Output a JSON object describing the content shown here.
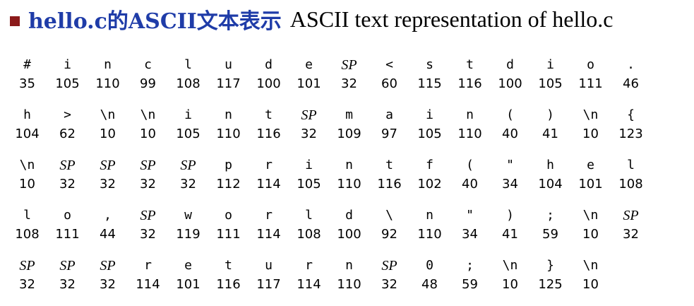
{
  "title": {
    "cn": "hello.c的ASCII文本表示",
    "en": "ASCII text representation of hello.c"
  },
  "colors": {
    "bullet": "#8b1a1a",
    "title_cn": "#1f3ca8"
  },
  "rows": [
    [
      {
        "ch": "#",
        "code": "35"
      },
      {
        "ch": "i",
        "code": "105"
      },
      {
        "ch": "n",
        "code": "110"
      },
      {
        "ch": "c",
        "code": "99"
      },
      {
        "ch": "l",
        "code": "108"
      },
      {
        "ch": "u",
        "code": "117"
      },
      {
        "ch": "d",
        "code": "100"
      },
      {
        "ch": "e",
        "code": "101"
      },
      {
        "ch": "SP",
        "code": "32"
      },
      {
        "ch": "<",
        "code": "60"
      },
      {
        "ch": "s",
        "code": "115"
      },
      {
        "ch": "t",
        "code": "116"
      },
      {
        "ch": "d",
        "code": "100"
      },
      {
        "ch": "i",
        "code": "105"
      },
      {
        "ch": "o",
        "code": "111"
      },
      {
        "ch": ".",
        "code": "46"
      }
    ],
    [
      {
        "ch": "h",
        "code": "104"
      },
      {
        "ch": ">",
        "code": "62"
      },
      {
        "ch": "\\n",
        "code": "10"
      },
      {
        "ch": "\\n",
        "code": "10"
      },
      {
        "ch": "i",
        "code": "105"
      },
      {
        "ch": "n",
        "code": "110"
      },
      {
        "ch": "t",
        "code": "116"
      },
      {
        "ch": "SP",
        "code": "32"
      },
      {
        "ch": "m",
        "code": "109"
      },
      {
        "ch": "a",
        "code": "97"
      },
      {
        "ch": "i",
        "code": "105"
      },
      {
        "ch": "n",
        "code": "110"
      },
      {
        "ch": "(",
        "code": "40"
      },
      {
        "ch": ")",
        "code": "41"
      },
      {
        "ch": "\\n",
        "code": "10"
      },
      {
        "ch": "{",
        "code": "123"
      }
    ],
    [
      {
        "ch": "\\n",
        "code": "10"
      },
      {
        "ch": "SP",
        "code": "32"
      },
      {
        "ch": "SP",
        "code": "32"
      },
      {
        "ch": "SP",
        "code": "32"
      },
      {
        "ch": "SP",
        "code": "32"
      },
      {
        "ch": "p",
        "code": "112"
      },
      {
        "ch": "r",
        "code": "114"
      },
      {
        "ch": "i",
        "code": "105"
      },
      {
        "ch": "n",
        "code": "110"
      },
      {
        "ch": "t",
        "code": "116"
      },
      {
        "ch": "f",
        "code": "102"
      },
      {
        "ch": "(",
        "code": "40"
      },
      {
        "ch": "\"",
        "code": "34"
      },
      {
        "ch": "h",
        "code": "104"
      },
      {
        "ch": "e",
        "code": "101"
      },
      {
        "ch": "l",
        "code": "108"
      }
    ],
    [
      {
        "ch": "l",
        "code": "108"
      },
      {
        "ch": "o",
        "code": "111"
      },
      {
        "ch": ",",
        "code": "44"
      },
      {
        "ch": "SP",
        "code": "32"
      },
      {
        "ch": "w",
        "code": "119"
      },
      {
        "ch": "o",
        "code": "111"
      },
      {
        "ch": "r",
        "code": "114"
      },
      {
        "ch": "l",
        "code": "108"
      },
      {
        "ch": "d",
        "code": "100"
      },
      {
        "ch": "\\",
        "code": "92"
      },
      {
        "ch": "n",
        "code": "110"
      },
      {
        "ch": "\"",
        "code": "34"
      },
      {
        "ch": ")",
        "code": "41"
      },
      {
        "ch": ";",
        "code": "59"
      },
      {
        "ch": "\\n",
        "code": "10"
      },
      {
        "ch": "SP",
        "code": "32"
      }
    ],
    [
      {
        "ch": "SP",
        "code": "32"
      },
      {
        "ch": "SP",
        "code": "32"
      },
      {
        "ch": "SP",
        "code": "32"
      },
      {
        "ch": "r",
        "code": "114"
      },
      {
        "ch": "e",
        "code": "101"
      },
      {
        "ch": "t",
        "code": "116"
      },
      {
        "ch": "u",
        "code": "117"
      },
      {
        "ch": "r",
        "code": "114"
      },
      {
        "ch": "n",
        "code": "110"
      },
      {
        "ch": "SP",
        "code": "32"
      },
      {
        "ch": "0",
        "code": "48"
      },
      {
        "ch": ";",
        "code": "59"
      },
      {
        "ch": "\\n",
        "code": "10"
      },
      {
        "ch": "}",
        "code": "125"
      },
      {
        "ch": "\\n",
        "code": "10"
      }
    ]
  ]
}
